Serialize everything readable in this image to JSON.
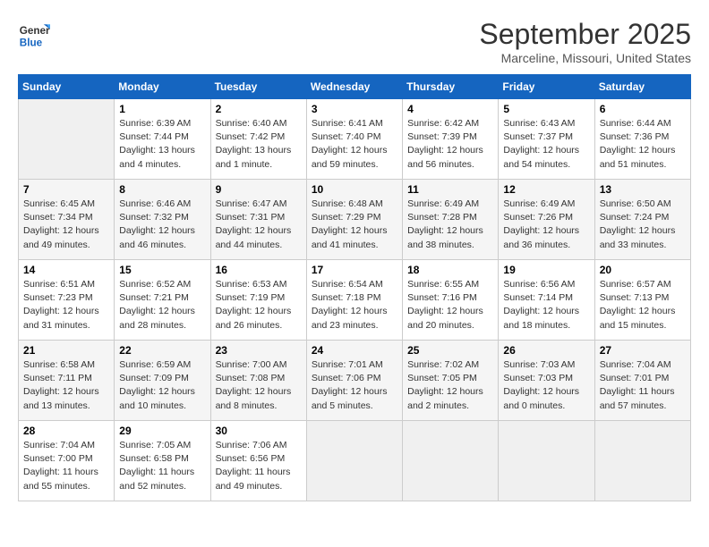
{
  "header": {
    "logo_line1": "General",
    "logo_line2": "Blue",
    "title": "September 2025",
    "subtitle": "Marceline, Missouri, United States"
  },
  "weekdays": [
    "Sunday",
    "Monday",
    "Tuesday",
    "Wednesday",
    "Thursday",
    "Friday",
    "Saturday"
  ],
  "weeks": [
    [
      {
        "day": "",
        "sunrise": "",
        "sunset": "",
        "daylight": ""
      },
      {
        "day": "1",
        "sunrise": "Sunrise: 6:39 AM",
        "sunset": "Sunset: 7:44 PM",
        "daylight": "Daylight: 13 hours and 4 minutes."
      },
      {
        "day": "2",
        "sunrise": "Sunrise: 6:40 AM",
        "sunset": "Sunset: 7:42 PM",
        "daylight": "Daylight: 13 hours and 1 minute."
      },
      {
        "day": "3",
        "sunrise": "Sunrise: 6:41 AM",
        "sunset": "Sunset: 7:40 PM",
        "daylight": "Daylight: 12 hours and 59 minutes."
      },
      {
        "day": "4",
        "sunrise": "Sunrise: 6:42 AM",
        "sunset": "Sunset: 7:39 PM",
        "daylight": "Daylight: 12 hours and 56 minutes."
      },
      {
        "day": "5",
        "sunrise": "Sunrise: 6:43 AM",
        "sunset": "Sunset: 7:37 PM",
        "daylight": "Daylight: 12 hours and 54 minutes."
      },
      {
        "day": "6",
        "sunrise": "Sunrise: 6:44 AM",
        "sunset": "Sunset: 7:36 PM",
        "daylight": "Daylight: 12 hours and 51 minutes."
      }
    ],
    [
      {
        "day": "7",
        "sunrise": "Sunrise: 6:45 AM",
        "sunset": "Sunset: 7:34 PM",
        "daylight": "Daylight: 12 hours and 49 minutes."
      },
      {
        "day": "8",
        "sunrise": "Sunrise: 6:46 AM",
        "sunset": "Sunset: 7:32 PM",
        "daylight": "Daylight: 12 hours and 46 minutes."
      },
      {
        "day": "9",
        "sunrise": "Sunrise: 6:47 AM",
        "sunset": "Sunset: 7:31 PM",
        "daylight": "Daylight: 12 hours and 44 minutes."
      },
      {
        "day": "10",
        "sunrise": "Sunrise: 6:48 AM",
        "sunset": "Sunset: 7:29 PM",
        "daylight": "Daylight: 12 hours and 41 minutes."
      },
      {
        "day": "11",
        "sunrise": "Sunrise: 6:49 AM",
        "sunset": "Sunset: 7:28 PM",
        "daylight": "Daylight: 12 hours and 38 minutes."
      },
      {
        "day": "12",
        "sunrise": "Sunrise: 6:49 AM",
        "sunset": "Sunset: 7:26 PM",
        "daylight": "Daylight: 12 hours and 36 minutes."
      },
      {
        "day": "13",
        "sunrise": "Sunrise: 6:50 AM",
        "sunset": "Sunset: 7:24 PM",
        "daylight": "Daylight: 12 hours and 33 minutes."
      }
    ],
    [
      {
        "day": "14",
        "sunrise": "Sunrise: 6:51 AM",
        "sunset": "Sunset: 7:23 PM",
        "daylight": "Daylight: 12 hours and 31 minutes."
      },
      {
        "day": "15",
        "sunrise": "Sunrise: 6:52 AM",
        "sunset": "Sunset: 7:21 PM",
        "daylight": "Daylight: 12 hours and 28 minutes."
      },
      {
        "day": "16",
        "sunrise": "Sunrise: 6:53 AM",
        "sunset": "Sunset: 7:19 PM",
        "daylight": "Daylight: 12 hours and 26 minutes."
      },
      {
        "day": "17",
        "sunrise": "Sunrise: 6:54 AM",
        "sunset": "Sunset: 7:18 PM",
        "daylight": "Daylight: 12 hours and 23 minutes."
      },
      {
        "day": "18",
        "sunrise": "Sunrise: 6:55 AM",
        "sunset": "Sunset: 7:16 PM",
        "daylight": "Daylight: 12 hours and 20 minutes."
      },
      {
        "day": "19",
        "sunrise": "Sunrise: 6:56 AM",
        "sunset": "Sunset: 7:14 PM",
        "daylight": "Daylight: 12 hours and 18 minutes."
      },
      {
        "day": "20",
        "sunrise": "Sunrise: 6:57 AM",
        "sunset": "Sunset: 7:13 PM",
        "daylight": "Daylight: 12 hours and 15 minutes."
      }
    ],
    [
      {
        "day": "21",
        "sunrise": "Sunrise: 6:58 AM",
        "sunset": "Sunset: 7:11 PM",
        "daylight": "Daylight: 12 hours and 13 minutes."
      },
      {
        "day": "22",
        "sunrise": "Sunrise: 6:59 AM",
        "sunset": "Sunset: 7:09 PM",
        "daylight": "Daylight: 12 hours and 10 minutes."
      },
      {
        "day": "23",
        "sunrise": "Sunrise: 7:00 AM",
        "sunset": "Sunset: 7:08 PM",
        "daylight": "Daylight: 12 hours and 8 minutes."
      },
      {
        "day": "24",
        "sunrise": "Sunrise: 7:01 AM",
        "sunset": "Sunset: 7:06 PM",
        "daylight": "Daylight: 12 hours and 5 minutes."
      },
      {
        "day": "25",
        "sunrise": "Sunrise: 7:02 AM",
        "sunset": "Sunset: 7:05 PM",
        "daylight": "Daylight: 12 hours and 2 minutes."
      },
      {
        "day": "26",
        "sunrise": "Sunrise: 7:03 AM",
        "sunset": "Sunset: 7:03 PM",
        "daylight": "Daylight: 12 hours and 0 minutes."
      },
      {
        "day": "27",
        "sunrise": "Sunrise: 7:04 AM",
        "sunset": "Sunset: 7:01 PM",
        "daylight": "Daylight: 11 hours and 57 minutes."
      }
    ],
    [
      {
        "day": "28",
        "sunrise": "Sunrise: 7:04 AM",
        "sunset": "Sunset: 7:00 PM",
        "daylight": "Daylight: 11 hours and 55 minutes."
      },
      {
        "day": "29",
        "sunrise": "Sunrise: 7:05 AM",
        "sunset": "Sunset: 6:58 PM",
        "daylight": "Daylight: 11 hours and 52 minutes."
      },
      {
        "day": "30",
        "sunrise": "Sunrise: 7:06 AM",
        "sunset": "Sunset: 6:56 PM",
        "daylight": "Daylight: 11 hours and 49 minutes."
      },
      {
        "day": "",
        "sunrise": "",
        "sunset": "",
        "daylight": ""
      },
      {
        "day": "",
        "sunrise": "",
        "sunset": "",
        "daylight": ""
      },
      {
        "day": "",
        "sunrise": "",
        "sunset": "",
        "daylight": ""
      },
      {
        "day": "",
        "sunrise": "",
        "sunset": "",
        "daylight": ""
      }
    ]
  ]
}
